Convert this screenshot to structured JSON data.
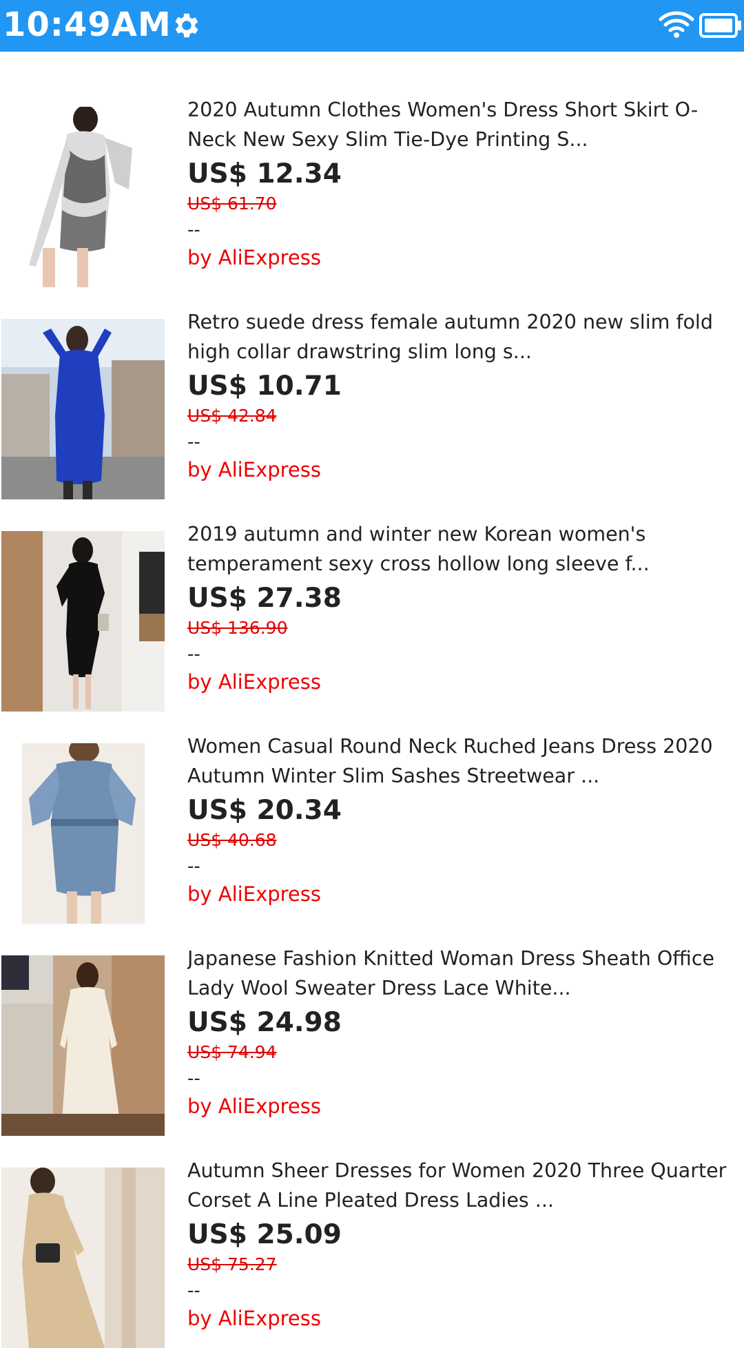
{
  "status_bar": {
    "time": "10:49AM",
    "color": "#2196f3",
    "icons": [
      "gear-icon",
      "wifi-icon",
      "battery-icon"
    ]
  },
  "products": [
    {
      "title": "2020 Autumn Clothes Women's Dress Short Skirt O-Neck New Sexy Slim Tie-Dye Printing S...",
      "price": "US$ 12.34",
      "original_price": "US$ 61.70",
      "rating": "--",
      "seller": "by AliExpress"
    },
    {
      "title": "Retro suede dress female autumn 2020 new slim fold high collar drawstring slim long s...",
      "price": "US$ 10.71",
      "original_price": "US$ 42.84",
      "rating": "--",
      "seller": "by AliExpress"
    },
    {
      "title": "2019 autumn and winter new Korean women's temperament sexy cross hollow long sleeve f...",
      "price": "US$ 27.38",
      "original_price": "US$ 136.90",
      "rating": "--",
      "seller": "by AliExpress"
    },
    {
      "title": "Women Casual Round Neck Ruched Jeans Dress 2020 Autumn Winter Slim Sashes Streetwear ...",
      "price": "US$ 20.34",
      "original_price": "US$ 40.68",
      "rating": "--",
      "seller": "by AliExpress"
    },
    {
      "title": "Japanese Fashion Knitted Woman Dress Sheath Office Lady Wool Sweater Dress Lace White...",
      "price": "US$ 24.98",
      "original_price": "US$ 74.94",
      "rating": "--",
      "seller": "by AliExpress"
    },
    {
      "title": "Autumn Sheer Dresses for Women 2020 Three Quarter Corset A Line Pleated Dress Ladies ...",
      "price": "US$ 25.09",
      "original_price": "US$ 75.27",
      "rating": "--",
      "seller": "by AliExpress"
    }
  ]
}
